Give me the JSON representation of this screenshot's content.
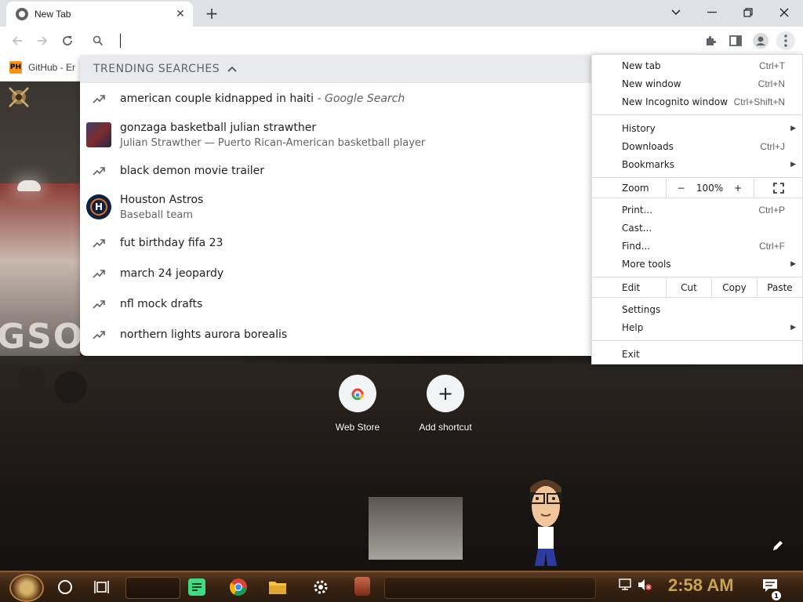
{
  "browser": {
    "tab": {
      "title": "New Tab",
      "close_glyph": "✕"
    },
    "new_tab_glyph": "+",
    "window_controls": {
      "dropdown": "chevron-down-icon",
      "minimize": "minimize-icon",
      "restore": "restore-icon",
      "close": "close-icon"
    },
    "toolbar_icons": [
      "back-icon",
      "forward-icon",
      "reload-icon",
      "search-icon",
      "extensions-icon",
      "side-panel-icon",
      "profile-icon",
      "menu-icon"
    ]
  },
  "bookmarks": [
    {
      "badge": "PH",
      "label": "GitHub - Er"
    }
  ],
  "omnibox": {
    "value": "",
    "dropdown": {
      "header": "TRENDING SEARCHES",
      "suggestions": [
        {
          "icon": "trending-icon",
          "text": "american couple kidnapped in haiti",
          "suffix": " - Google Search"
        },
        {
          "icon": "thumbnail",
          "text": "gonzaga basketball julian strawther",
          "subtitle": "Julian Strawther — Puerto Rican-American basketball player"
        },
        {
          "icon": "trending-icon",
          "text": "black demon movie trailer"
        },
        {
          "icon": "astros-logo",
          "text": "Houston Astros",
          "subtitle": "Baseball team",
          "logo_text": "H"
        },
        {
          "icon": "trending-icon",
          "text": "fut birthday fifa 23"
        },
        {
          "icon": "trending-icon",
          "text": "march 24 jeopardy"
        },
        {
          "icon": "trending-icon",
          "text": "nfl mock drafts"
        },
        {
          "icon": "trending-icon",
          "text": "northern lights aurora borealis"
        }
      ]
    }
  },
  "menu": {
    "items": [
      {
        "label": "New tab",
        "shortcut": "Ctrl+T"
      },
      {
        "label": "New window",
        "shortcut": "Ctrl+N"
      },
      {
        "label": "New Incognito window",
        "shortcut": "Ctrl+Shift+N"
      },
      {
        "label": "History",
        "submenu": true
      },
      {
        "label": "Downloads",
        "shortcut": "Ctrl+J"
      },
      {
        "label": "Bookmarks",
        "submenu": true
      },
      {
        "label": "Print...",
        "shortcut": "Ctrl+P"
      },
      {
        "label": "Cast..."
      },
      {
        "label": "Find...",
        "shortcut": "Ctrl+F"
      },
      {
        "label": "More tools",
        "submenu": true
      },
      {
        "label": "Settings"
      },
      {
        "label": "Help",
        "submenu": true
      },
      {
        "label": "Exit"
      }
    ],
    "zoom": {
      "label": "Zoom",
      "minus": "−",
      "value": "100%",
      "plus": "+",
      "fullscreen_icon": "fullscreen-icon"
    },
    "edit": {
      "label": "Edit",
      "cut": "Cut",
      "copy": "Copy",
      "paste": "Paste"
    },
    "submenu_arrow": "▶"
  },
  "new_tab_page": {
    "shortcuts": [
      {
        "label": "Web Store",
        "icon": "chrome-web-store-icon"
      },
      {
        "label": "Add shortcut",
        "icon": "plus-icon",
        "glyph": "+"
      }
    ]
  },
  "taskbar": {
    "apps": [
      "start-orb",
      "cortana-circle-icon",
      "task-view-icon",
      "spotify-icon",
      "chrome-icon",
      "file-explorer-icon",
      "settings-gear-icon",
      "app-icon"
    ],
    "clock": "2:58 AM",
    "notification_count": "1"
  }
}
